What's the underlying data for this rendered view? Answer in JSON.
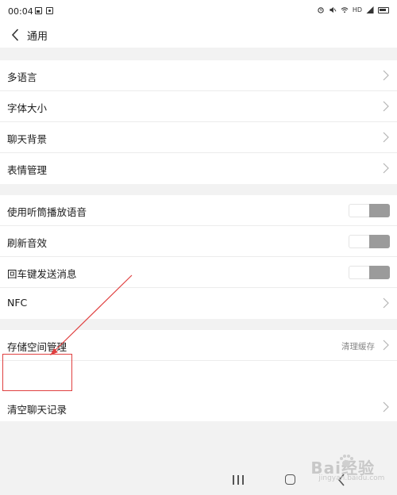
{
  "status_bar": {
    "time": "00:04",
    "right_text": "HD"
  },
  "header": {
    "title": "通用"
  },
  "groups": [
    {
      "items": [
        {
          "label": "多语言",
          "control": "chevron"
        },
        {
          "label": "字体大小",
          "control": "chevron"
        },
        {
          "label": "聊天背景",
          "control": "chevron"
        },
        {
          "label": "表情管理",
          "control": "chevron"
        }
      ]
    },
    {
      "items": [
        {
          "label": "使用听筒播放语音",
          "control": "toggle",
          "on": false
        },
        {
          "label": "刷新音效",
          "control": "toggle",
          "on": false
        },
        {
          "label": "回车键发送消息",
          "control": "toggle",
          "on": false
        },
        {
          "label": "NFC",
          "control": "chevron"
        }
      ]
    },
    {
      "items": [
        {
          "label": "存储空间管理",
          "control": "chevron",
          "value": "清理缓存"
        },
        {
          "label": "清空聊天记录",
          "control": "chevron"
        }
      ]
    }
  ],
  "annotation": {
    "highlight_color": "#e04040"
  },
  "watermark": {
    "main": "Bai经验",
    "sub": "jingyan.baidu.com"
  },
  "colors": {
    "background": "#f2f2f2",
    "card": "#ffffff",
    "toggle_off_dark": "#9b9b9b",
    "secondary_text": "#8a8a8a"
  }
}
